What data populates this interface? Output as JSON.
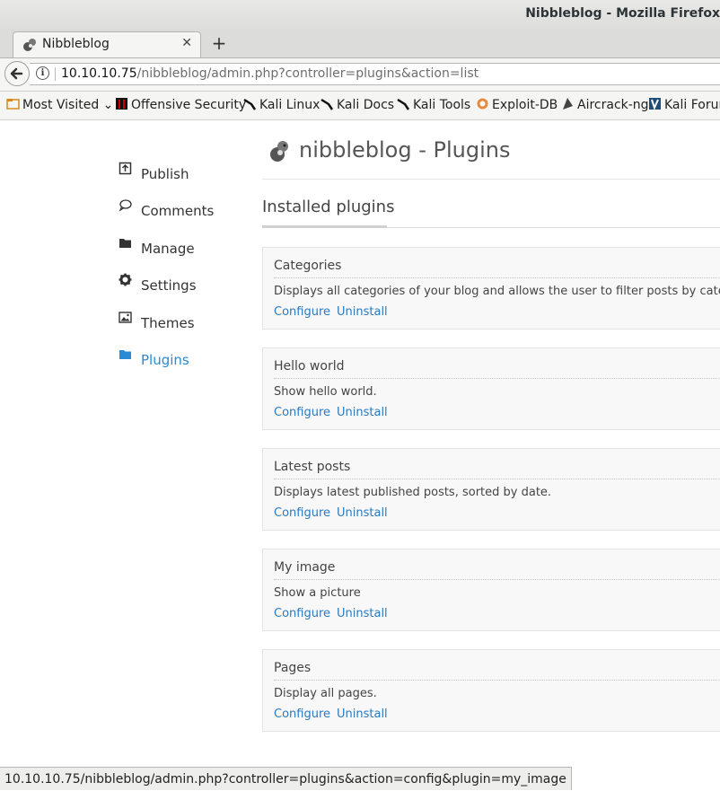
{
  "window": {
    "title": "Nibbleblog - Mozilla Firefox"
  },
  "tabs": [
    {
      "label": "Nibbleblog"
    }
  ],
  "urlbar": {
    "host": "10.10.10.75",
    "path": "/nibbleblog/admin.php?controller=plugins&action=list"
  },
  "bookmarks": [
    {
      "label": "Most Visited",
      "icon": "folder-icon"
    },
    {
      "label": "Offensive Security",
      "icon": "offsec-icon"
    },
    {
      "label": "Kali Linux",
      "icon": "kali-dragon-icon"
    },
    {
      "label": "Kali Docs",
      "icon": "kali-dragon-icon"
    },
    {
      "label": "Kali Tools",
      "icon": "kali-dragon-icon"
    },
    {
      "label": "Exploit-DB",
      "icon": "exploit-db-icon"
    },
    {
      "label": "Aircrack-ng",
      "icon": "aircrack-icon"
    },
    {
      "label": "Kali Forums",
      "icon": "kali-forums-icon"
    }
  ],
  "sidebar": {
    "items": [
      {
        "label": "Publish",
        "icon": "publish-icon"
      },
      {
        "label": "Comments",
        "icon": "comment-icon"
      },
      {
        "label": "Manage",
        "icon": "folder-icon"
      },
      {
        "label": "Settings",
        "icon": "gear-icon"
      },
      {
        "label": "Themes",
        "icon": "image-icon"
      },
      {
        "label": "Plugins",
        "icon": "folder-icon",
        "active": true
      }
    ]
  },
  "page": {
    "header": "nibbleblog - Plugins",
    "section_title": "Installed plugins"
  },
  "plugins": [
    {
      "name": "Categories",
      "description": "Displays all categories of your blog and allows the user to filter posts by category.",
      "configure": "Configure",
      "uninstall": "Uninstall"
    },
    {
      "name": "Hello world",
      "description": "Show hello world.",
      "configure": "Configure",
      "uninstall": "Uninstall"
    },
    {
      "name": "Latest posts",
      "description": "Displays latest published posts, sorted by date.",
      "configure": "Configure",
      "uninstall": "Uninstall"
    },
    {
      "name": "My image",
      "description": "Show a picture",
      "configure": "Configure",
      "uninstall": "Uninstall"
    },
    {
      "name": "Pages",
      "description": "Display all pages.",
      "configure": "Configure",
      "uninstall": "Uninstall"
    }
  ],
  "statusbar": {
    "text": "10.10.10.75/nibbleblog/admin.php?controller=plugins&action=config&plugin=my_image"
  },
  "colors": {
    "link": "#2a7ac1",
    "active_nav": "#2a8ad6"
  }
}
